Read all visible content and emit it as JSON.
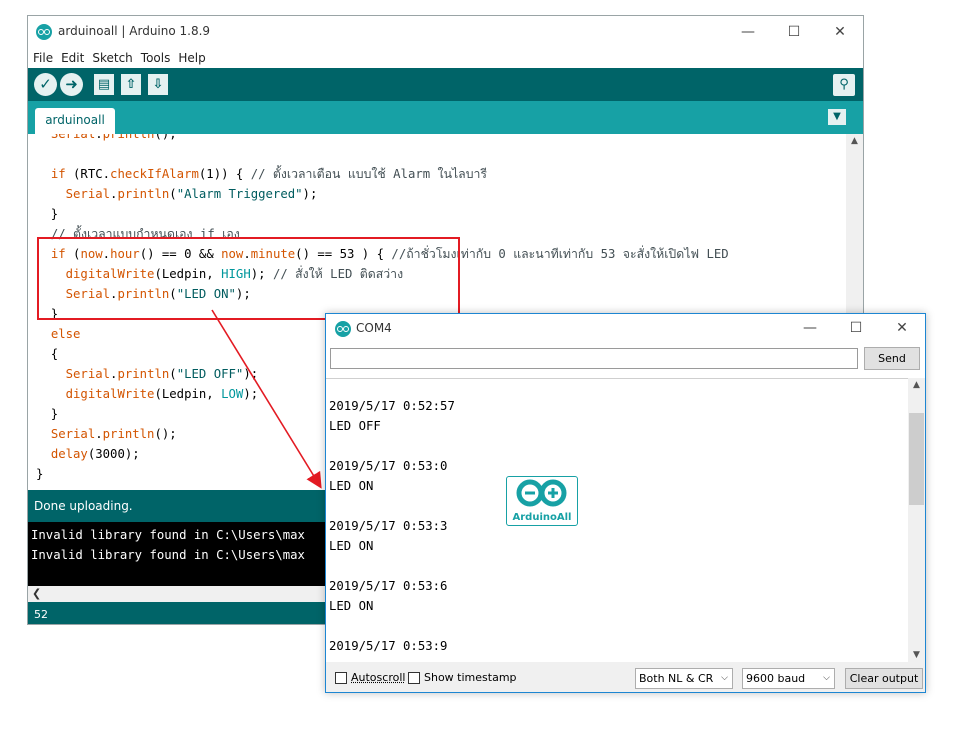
{
  "ide": {
    "title": "arduinoall | Arduino 1.8.9",
    "menu": [
      "File",
      "Edit",
      "Sketch",
      "Tools",
      "Help"
    ],
    "tab": "arduinoall",
    "code_lines": [
      "  Serial.println();",
      "",
      "  if (RTC.checkIfAlarm(1)) { // ตั้งเวลาเตือน แบบใช้ Alarm ในไลบารี",
      "    Serial.println(\"Alarm Triggered\");",
      "  }",
      "  // ตั้งเวลาแบบกำหนดเอง if เอง",
      "  if (now.hour() == 0 && now.minute() == 53 ) { //ถ้าชั่วโมงเท่ากับ 0 และนาทีเท่ากับ 53 จะสั่งให้เปิดไฟ LED",
      "    digitalWrite(Ledpin, HIGH); // สั่งให้ LED ติดสว่าง",
      "    Serial.println(\"LED ON\");",
      "  }",
      "  else",
      "  {",
      "    Serial.println(\"LED OFF\");",
      "    digitalWrite(Ledpin, LOW);",
      "  }",
      "  Serial.println();",
      "  delay(3000);",
      "}"
    ],
    "status": "Done uploading.",
    "console": [
      "Invalid library found in C:\\Users\\max",
      "Invalid library found in C:\\Users\\max"
    ],
    "line_number": "52"
  },
  "serial": {
    "title": "COM4",
    "input_value": "",
    "send_label": "Send",
    "output": [
      "2019/5/17 0:52:57",
      "LED OFF",
      "",
      "2019/5/17 0:53:0",
      "LED ON",
      "",
      "2019/5/17 0:53:3",
      "LED ON",
      "",
      "2019/5/17 0:53:6",
      "LED ON",
      "",
      "2019/5/17 0:53:9"
    ],
    "logo_text": "ArduinoAll",
    "autoscroll_label": "Autoscroll",
    "timestamp_label": "Show timestamp",
    "line_ending": "Both NL & CR",
    "baud": "9600 baud",
    "clear_label": "Clear output"
  },
  "colors": {
    "teal_dark": "#006468",
    "teal": "#17a1a5",
    "annotation_red": "#e31b23"
  },
  "icons": [
    "arduino-app-icon",
    "verify-icon",
    "upload-icon",
    "new-icon",
    "open-icon",
    "save-icon",
    "serial-monitor-icon",
    "minimize-icon",
    "maximize-icon",
    "close-icon"
  ]
}
